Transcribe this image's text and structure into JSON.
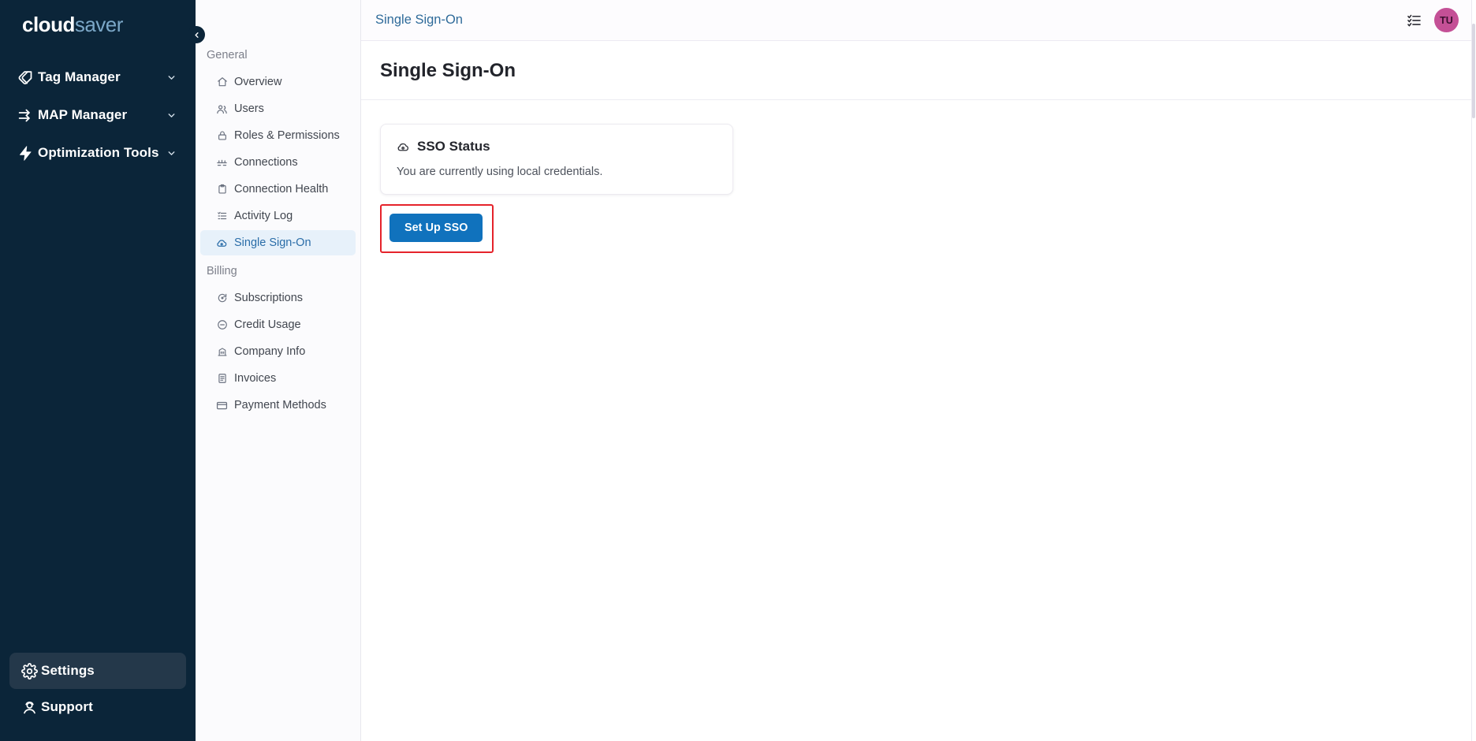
{
  "brand": {
    "part1": "cloud",
    "part2": "saver"
  },
  "sidebar": {
    "items": [
      {
        "label": "Tag Manager",
        "icon": "tag-icon",
        "chevron": "⌄"
      },
      {
        "label": "MAP Manager",
        "icon": "arrows-right-icon",
        "chevron": "⌄"
      },
      {
        "label": "Optimization Tools",
        "icon": "bolt-icon",
        "chevron": "⌄"
      }
    ],
    "bottom": [
      {
        "label": "Settings",
        "icon": "gear-icon",
        "active": true
      },
      {
        "label": "Support",
        "icon": "support-agent-icon",
        "active": false
      }
    ],
    "collapse_glyph": "‹"
  },
  "subnav": {
    "groups": [
      {
        "title": "General",
        "items": [
          {
            "label": "Overview",
            "icon": "home-icon"
          },
          {
            "label": "Users",
            "icon": "users-icon"
          },
          {
            "label": "Roles & Permissions",
            "icon": "lock-icon"
          },
          {
            "label": "Connections",
            "icon": "network-icon"
          },
          {
            "label": "Connection Health",
            "icon": "clipboard-icon"
          },
          {
            "label": "Activity Log",
            "icon": "list-icon"
          },
          {
            "label": "Single Sign-On",
            "icon": "cloud-icon"
          }
        ]
      },
      {
        "title": "Billing",
        "items": [
          {
            "label": "Subscriptions",
            "icon": "refresh-icon"
          },
          {
            "label": "Credit Usage",
            "icon": "circle-minus-icon"
          },
          {
            "label": "Company Info",
            "icon": "building-icon"
          },
          {
            "label": "Invoices",
            "icon": "document-icon"
          },
          {
            "label": "Payment Methods",
            "icon": "credit-card-icon"
          }
        ]
      }
    ]
  },
  "topbar": {
    "breadcrumb": "Single Sign-On",
    "checklist_icon": "checklist-icon",
    "avatar_initials": "TU"
  },
  "page": {
    "title": "Single Sign-On",
    "card": {
      "icon": "cloud-icon",
      "title": "SSO Status",
      "body": "You are currently using local credentials."
    },
    "cta_label": "Set Up SSO"
  },
  "colors": {
    "sidebar_bg": "#0b2539",
    "accent_blue": "#1072bd",
    "breadcrumb_blue": "#2f6b9a",
    "highlight_red": "#e5232b",
    "avatar_bg": "#c45096",
    "active_subnav_bg": "#e7f1fa"
  }
}
